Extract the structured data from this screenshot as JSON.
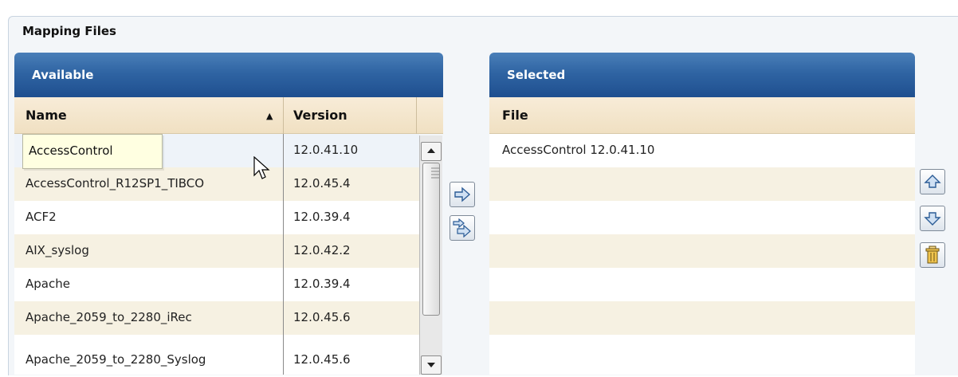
{
  "section": {
    "title": "Mapping Files"
  },
  "available": {
    "title": "Available",
    "columns": {
      "name": "Name",
      "version": "Version"
    },
    "sort_indicator": "▲",
    "rows": [
      {
        "name": "",
        "version": "12.0.41.10"
      },
      {
        "name": "AccessControl_R12SP1_TIBCO",
        "version": "12.0.45.4"
      },
      {
        "name": "ACF2",
        "version": "12.0.39.4"
      },
      {
        "name": "AIX_syslog",
        "version": "12.0.42.2"
      },
      {
        "name": "Apache",
        "version": "12.0.39.4"
      },
      {
        "name": "Apache_2059_to_2280_iRec",
        "version": "12.0.45.6"
      },
      {
        "name": "Apache_2059_to_2280_Syslog",
        "version": "12.0.45.6"
      }
    ]
  },
  "tooltip": {
    "text": "AccessControl"
  },
  "selected": {
    "title": "Selected",
    "columns": {
      "file": "File"
    },
    "rows": [
      "AccessControl 12.0.41.10",
      "",
      "",
      "",
      "",
      "",
      ""
    ]
  },
  "icons": {
    "add": "arrow-right-icon",
    "add_all": "double-arrow-right-icon",
    "move_up": "arrow-up-icon",
    "move_down": "arrow-down-icon",
    "delete": "trash-icon",
    "cursor": "pointer-cursor-icon"
  },
  "colors": {
    "header_blue": "#2f64a3",
    "column_header_tan": "#f0e0c2",
    "row_alt": "#f6f1e2",
    "tooltip_bg": "#ffffe1"
  }
}
